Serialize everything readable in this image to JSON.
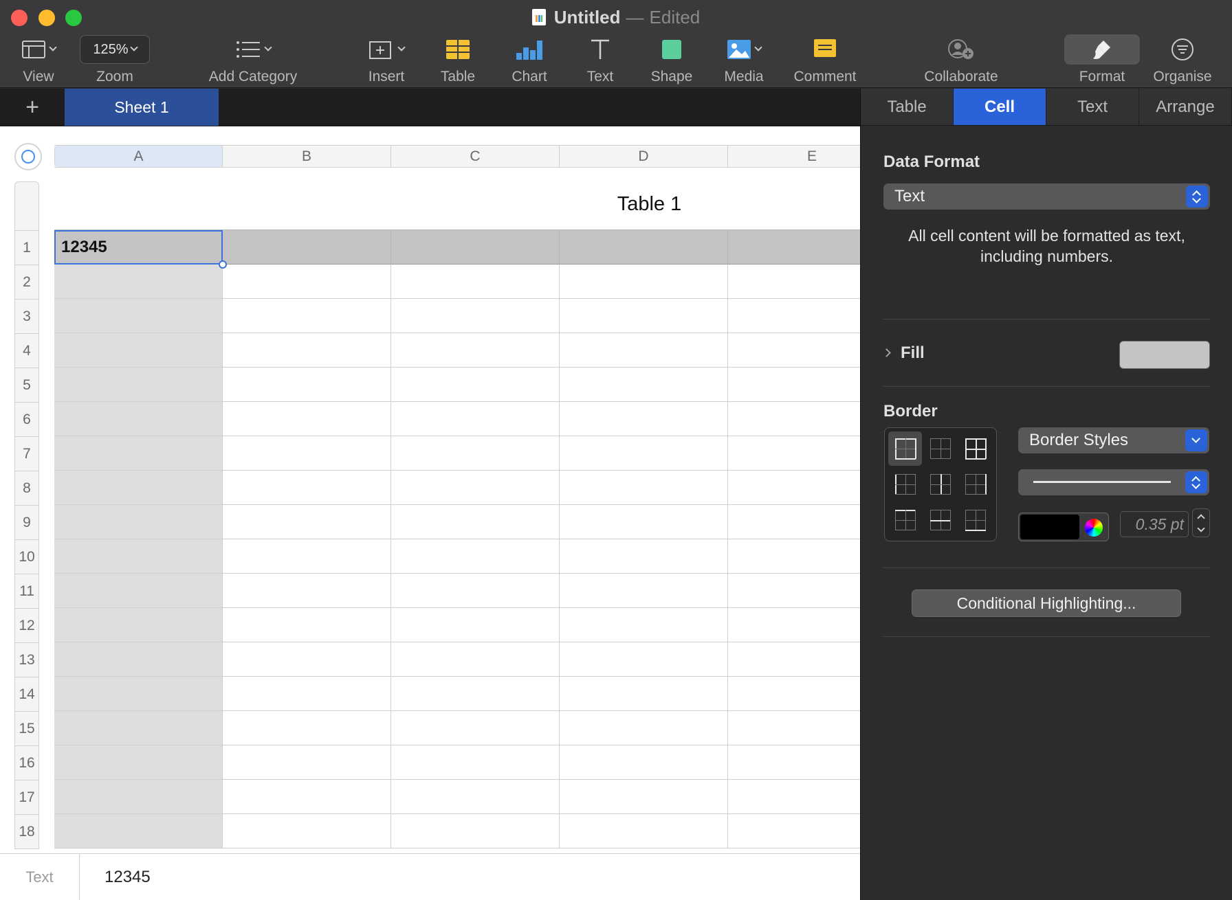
{
  "window": {
    "title": "Untitled",
    "separator": "—",
    "status": "Edited"
  },
  "toolbar": {
    "view_label": "View",
    "zoom_value": "125%",
    "zoom_label": "Zoom",
    "add_category_label": "Add Category",
    "insert_label": "Insert",
    "table_label": "Table",
    "chart_label": "Chart",
    "text_label": "Text",
    "shape_label": "Shape",
    "media_label": "Media",
    "comment_label": "Comment",
    "collaborate_label": "Collaborate",
    "format_label": "Format",
    "organise_label": "Organise"
  },
  "sheets": {
    "add_symbol": "+",
    "tabs": [
      {
        "label": "Sheet 1",
        "active": true
      }
    ]
  },
  "table": {
    "title": "Table 1",
    "columns": [
      "A",
      "B",
      "C",
      "D",
      "E"
    ],
    "rows": [
      "1",
      "2",
      "3",
      "4",
      "5",
      "6",
      "7",
      "8",
      "9",
      "10",
      "11",
      "12",
      "13",
      "14",
      "15",
      "16",
      "17",
      "18"
    ],
    "cells": {
      "A1": "12345"
    },
    "selected_cell": "A1"
  },
  "statusbar": {
    "type": "Text",
    "value": "12345"
  },
  "inspector": {
    "tabs": [
      {
        "label": "Table",
        "active": false
      },
      {
        "label": "Cell",
        "active": true
      },
      {
        "label": "Text",
        "active": false
      },
      {
        "label": "Arrange",
        "active": false
      }
    ],
    "data_format": {
      "title": "Data Format",
      "value": "Text",
      "description_line1": "All cell content will be formatted as text,",
      "description_line2": "including numbers."
    },
    "fill": {
      "title": "Fill",
      "color": "#c4c4c4"
    },
    "border": {
      "title": "Border",
      "styles_label": "Border Styles",
      "color": "#000000",
      "width": "0.35 pt"
    },
    "conditional_label": "Conditional Highlighting..."
  },
  "colors": {
    "accent": "#2962d9",
    "selection": "#3b73d9",
    "header_row": "#c4c4c4",
    "header_col": "#dedede"
  }
}
